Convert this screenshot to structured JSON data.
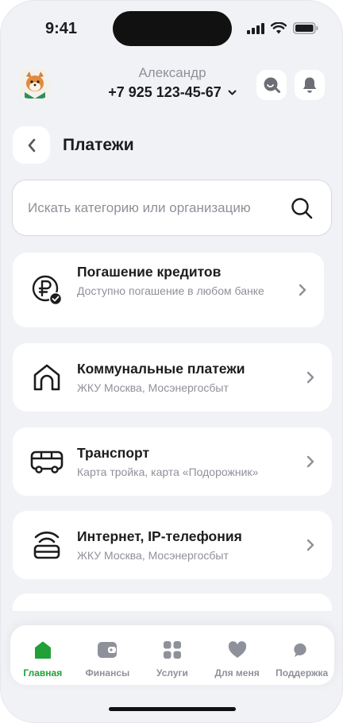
{
  "status_bar": {
    "time": "9:41"
  },
  "header": {
    "user_name": "Александр",
    "phone": "+7 925 123-45-67",
    "icons": [
      "avatar-fox",
      "search-chat-icon",
      "bell-icon"
    ]
  },
  "page": {
    "back_icon": "chevron-left-icon",
    "title": "Платежи"
  },
  "search": {
    "placeholder": "Искать категорию или организацию",
    "value": "",
    "icon": "search-icon"
  },
  "categories": [
    {
      "title": "Погашение кредитов",
      "subtitle": "Доступно погашение в любом банке",
      "icon": "ruble-check-icon"
    },
    {
      "title": "Коммунальные платежи",
      "subtitle": "ЖКУ Москва, Мосэнергосбыт",
      "icon": "house-icon"
    },
    {
      "title": "Транспорт",
      "subtitle": "Карта тройка, карта «Подорожник»",
      "icon": "bus-icon"
    },
    {
      "title": "Интернет, IP-телефония",
      "subtitle": "ЖКУ Москва, Мосэнергосбыт",
      "icon": "router-icon"
    }
  ],
  "tabbar": {
    "active": "Главная",
    "active_color": "#21a038",
    "items": [
      {
        "label": "Главная",
        "icon": "home-icon"
      },
      {
        "label": "Финансы",
        "icon": "wallet-icon"
      },
      {
        "label": "Услуги",
        "icon": "grid-icon"
      },
      {
        "label": "Для меня",
        "icon": "heart-icon"
      },
      {
        "label": "Поддержка",
        "icon": "chat-icon"
      }
    ]
  }
}
